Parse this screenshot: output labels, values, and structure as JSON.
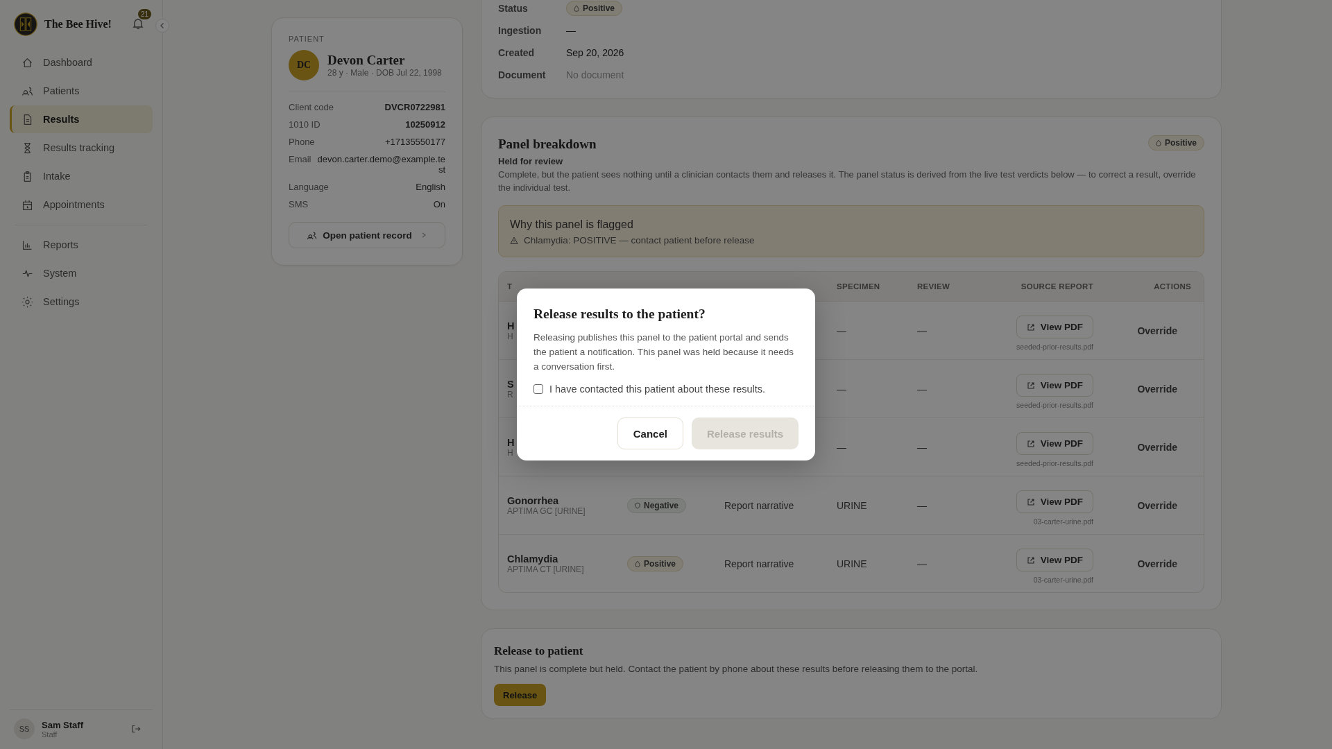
{
  "sidebar": {
    "brand": "The Bee Hive!",
    "notification_count": "21",
    "items": [
      {
        "label": "Dashboard",
        "selected": false
      },
      {
        "label": "Patients",
        "selected": false
      },
      {
        "label": "Results",
        "selected": true
      },
      {
        "label": "Results tracking",
        "selected": false
      },
      {
        "label": "Intake",
        "selected": false
      },
      {
        "label": "Appointments",
        "selected": false
      },
      {
        "label": "Reports",
        "selected": false
      },
      {
        "label": "System",
        "selected": false
      },
      {
        "label": "Settings",
        "selected": false
      }
    ],
    "user": {
      "initials": "SS",
      "name": "Sam Staff",
      "role": "Staff"
    }
  },
  "patient": {
    "section_label": "PATIENT",
    "initials": "DC",
    "name": "Devon Carter",
    "summary": "28 y · Male · DOB Jul 22, 1998",
    "fields": [
      {
        "label": "Client code",
        "value": "DVCR0722981",
        "strong": true
      },
      {
        "label": "1010 ID",
        "value": "10250912",
        "strong": true
      },
      {
        "label": "Phone",
        "value": "+17135550177",
        "strong": false
      },
      {
        "label": "Email",
        "value": "devon.carter.demo@example.test",
        "strong": false
      },
      {
        "label": "Language",
        "value": "English",
        "strong": false
      },
      {
        "label": "SMS",
        "value": "On",
        "strong": false
      }
    ],
    "button": "Open patient record"
  },
  "details": [
    {
      "label": "Status",
      "kind": "badge",
      "badge": {
        "kind": "positive",
        "text": "Positive"
      }
    },
    {
      "label": "Ingestion",
      "kind": "text",
      "value": "—"
    },
    {
      "label": "Created",
      "kind": "text",
      "value": "Sep 20, 2026"
    },
    {
      "label": "Document",
      "kind": "muted",
      "value": "No document"
    }
  ],
  "panel": {
    "title": "Panel breakdown",
    "badge": {
      "kind": "positive",
      "text": "Positive"
    },
    "status_title": "Held for review",
    "description": "Complete, but the patient sees nothing until a clinician contacts them and releases it. The panel status is derived from the live test verdicts below — to correct a result, override the individual test.",
    "flag": {
      "title": "Why this panel is flagged",
      "message": "Chlamydia: POSITIVE — contact patient before release"
    },
    "table": {
      "columns": [
        {
          "label": "T"
        },
        {
          "label": "SPECIMEN"
        },
        {
          "label": "REVIEW"
        },
        {
          "label": "SOURCE REPORT"
        },
        {
          "label": "ACTIONS"
        }
      ],
      "rows": [
        {
          "test": "H",
          "code": "H",
          "specimen": "—",
          "review": "—",
          "button": "View PDF",
          "file": "seeded-prior-results.pdf",
          "action": "Override"
        },
        {
          "test": "S",
          "code": "R",
          "specimen": "—",
          "review": "—",
          "button": "View PDF",
          "file": "seeded-prior-results.pdf",
          "action": "Override"
        },
        {
          "test": "H",
          "code": "H",
          "specimen": "—",
          "review": "—",
          "button": "View PDF",
          "file": "seeded-prior-results.pdf",
          "action": "Override"
        },
        {
          "test": "Gonorrhea",
          "code": "APTIMA GC [URINE]",
          "verdict": {
            "kind": "negative",
            "text": "Negative"
          },
          "method": "Report narrative",
          "specimen": "URINE",
          "review": "—",
          "button": "View PDF",
          "file": "03-carter-urine.pdf",
          "action": "Override"
        },
        {
          "test": "Chlamydia",
          "code": "APTIMA CT [URINE]",
          "verdict": {
            "kind": "positive",
            "text": "Positive"
          },
          "method": "Report narrative",
          "specimen": "URINE",
          "review": "—",
          "button": "View PDF",
          "file": "03-carter-urine.pdf",
          "action": "Override"
        }
      ]
    }
  },
  "release": {
    "title": "Release to patient",
    "text": "This panel is complete but held. Contact the patient by phone about these results before releasing them to the portal.",
    "button": "Release"
  },
  "modal": {
    "title": "Release results to the patient?",
    "body": "Releasing publishes this panel to the patient portal and sends the patient a notification. This panel was held because it needs a conversation first.",
    "checkbox": {
      "label": "I have contacted this patient about these results.",
      "checked": false
    },
    "cancel": "Cancel",
    "confirm": {
      "label": "Release results",
      "disabled": true
    }
  }
}
